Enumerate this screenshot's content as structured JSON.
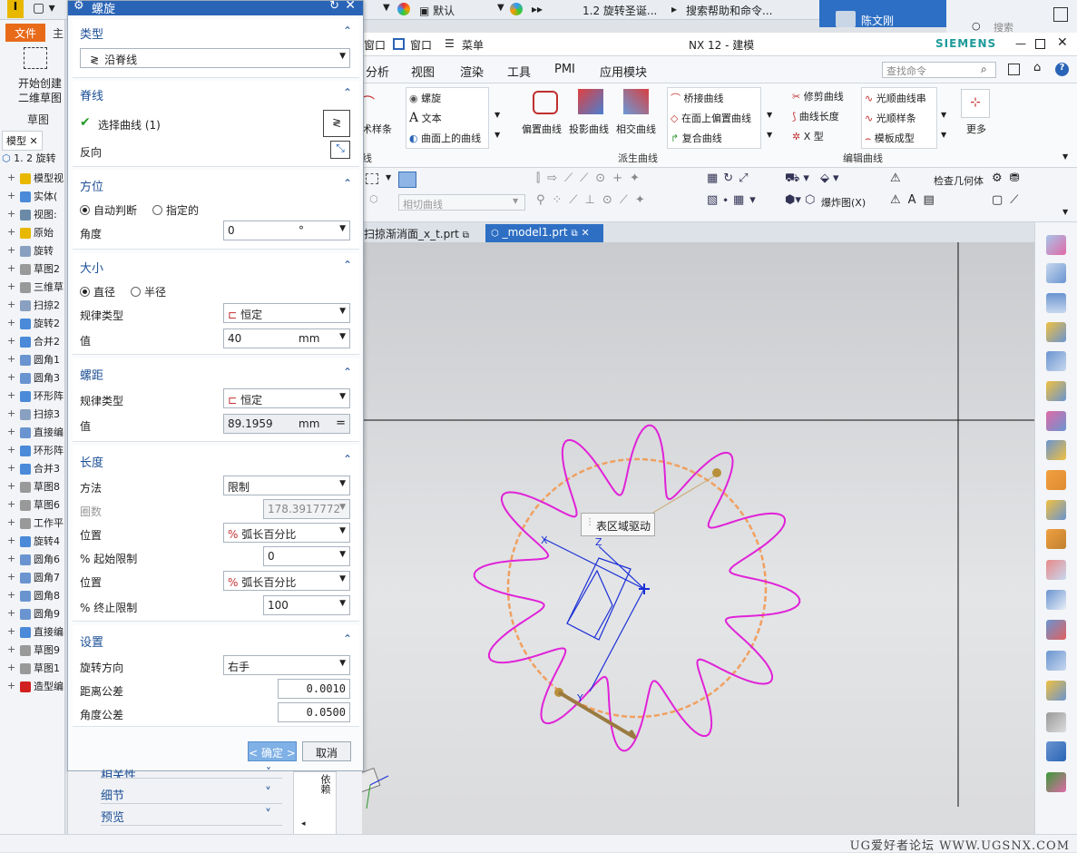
{
  "top_strip": {
    "quick_labels": [
      "默认",
      "1.2 旋转圣诞...",
      "搜索帮助和命令..."
    ],
    "user_name": "陈文刚",
    "search_placeholder": "搜索"
  },
  "window": {
    "title": "NX 12 - 建模",
    "brand": "SIEMENS",
    "menu_window_switch": "窗口",
    "menu_window": "窗口",
    "menu_main": "菜单",
    "find_command_placeholder": "查找命令"
  },
  "menubar": [
    "分析",
    "视图",
    "渲染",
    "工具",
    "PMI",
    "应用模块"
  ],
  "ribbon": {
    "curve_group_truncated": "术样条",
    "curve_group_label_truncated": "线",
    "helix": "螺旋",
    "text": "文本",
    "curve_on_surface": "曲面上的曲线",
    "offset_curve": "偏置曲线",
    "projected_curve": "投影曲线",
    "intersect_curve": "相交曲线",
    "bridge_curve": "桥接曲线",
    "offset_in_face": "在面上偏置曲线",
    "composite_curve": "复合曲线",
    "derived_group": "派生曲线",
    "trim_curve": "修剪曲线",
    "curve_length": "曲线长度",
    "x_form": "X 型",
    "smooth_curve_string": "光顺曲线串",
    "smooth_spline": "光顺样条",
    "template_shape": "模板成型",
    "edit_group": "编辑曲线",
    "more": "更多",
    "tangent_curve_placeholder": "相切曲线",
    "check_geometry": "检查几何体",
    "exploded_view": "爆炸图(X)"
  },
  "tabs": [
    {
      "label": "扫掠渐消面_x_t.prt",
      "active": false
    },
    {
      "label": "_model1.prt",
      "active": true
    }
  ],
  "left": {
    "file_tab": "文件",
    "home_tab": "主",
    "start_sketch": "开始创建二维草图",
    "sketch_group": "草图",
    "model_tab": "模型",
    "tree_root": "1. 2 旋转",
    "tree_items": [
      "模型视",
      "实体(",
      "视图:",
      "原始",
      "旋转",
      "草图2",
      "三维草",
      "扫掠2",
      "旋转2",
      "合并2",
      "圆角1",
      "圆角3",
      "环形阵",
      "扫掠3",
      "直接编",
      "环形阵",
      "合并3",
      "草图8",
      "草图6",
      "工作平",
      "旋转4",
      "圆角6",
      "圆角7",
      "圆角8",
      "圆角9",
      "直接编",
      "草图9",
      "草图1",
      "造型编"
    ]
  },
  "dialog": {
    "title": "螺旋",
    "type": {
      "header": "类型",
      "value": "沿脊线"
    },
    "spine": {
      "header": "脊线",
      "select_label": "选择曲线 (1)",
      "reverse_label": "反向"
    },
    "orientation": {
      "header": "方位",
      "opt_auto": "自动判断",
      "opt_specified": "指定的",
      "angle_label": "角度",
      "angle_value": "0",
      "angle_unit": "°"
    },
    "size": {
      "header": "大小",
      "opt_diameter": "直径",
      "opt_radius": "半径",
      "law_label": "规律类型",
      "law_value": "恒定",
      "value_label": "值",
      "value": "40",
      "unit": "mm"
    },
    "pitch": {
      "header": "螺距",
      "law_label": "规律类型",
      "law_value": "恒定",
      "value_label": "值",
      "value": "89.1959",
      "unit": "mm"
    },
    "length": {
      "header": "长度",
      "method_label": "方法",
      "method_value": "限制",
      "turns_label": "圈数",
      "turns_value": "178.3917772",
      "pos_label": "位置",
      "pos_value": "弧长百分比",
      "start_label": "% 起始限制",
      "start_value": "0",
      "pos2_label": "位置",
      "pos2_value": "弧长百分比",
      "end_label": "% 终止限制",
      "end_value": "100"
    },
    "settings": {
      "header": "设置",
      "rotation_label": "旋转方向",
      "rotation_value": "右手",
      "dist_tol_label": "距离公差",
      "dist_tol_value": "0.0010",
      "angle_tol_label": "角度公差",
      "angle_tol_value": "0.0500"
    },
    "ok": "< 确定 >",
    "cancel": "取消"
  },
  "lower_panel": {
    "rows": [
      "相关性",
      "细节",
      "预览"
    ],
    "side_label": "依赖"
  },
  "viewport": {
    "tooltip": "表区域驱动",
    "axis_x": "X",
    "axis_y": "Y",
    "axis_z": "Z"
  },
  "status": {
    "watermark": "UG爱好者论坛 WWW.UGSNX.COM"
  },
  "colors": {
    "accent": "#2a64b6",
    "helix": "#e022d8",
    "circle": "#f0a060",
    "file_tab": "#e86b1a",
    "wcs": "#1a2fd6"
  }
}
